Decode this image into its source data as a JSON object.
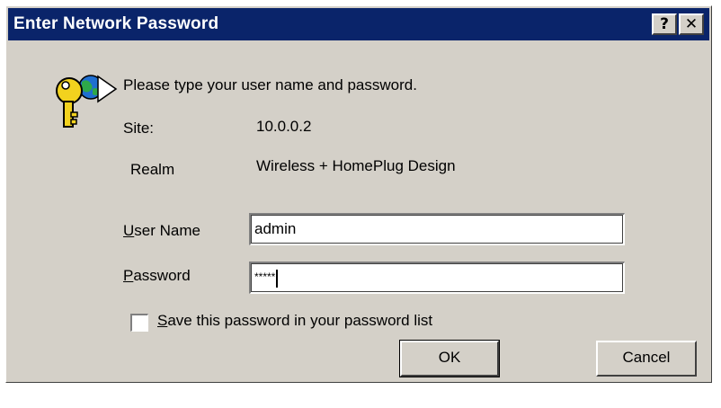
{
  "dialog": {
    "title": "Enter Network Password",
    "help_glyph": "?",
    "close_glyph": "✕",
    "prompt": "Please type your user name and password.",
    "icon": "key-icon"
  },
  "site": {
    "label": "Site:",
    "value": "10.0.0.2"
  },
  "realm": {
    "label": "Realm",
    "value": "Wireless + HomePlug Design"
  },
  "username": {
    "label_mnemonic": "U",
    "label_rest": "ser Name",
    "value": "admin"
  },
  "password": {
    "label_mnemonic": "P",
    "label_rest": "assword",
    "value_masked": "*****"
  },
  "save_password": {
    "label_mnemonic": "S",
    "label_rest": "ave this password in your password list",
    "checked": false
  },
  "buttons": {
    "ok": "OK",
    "cancel": "Cancel"
  },
  "colors": {
    "titlebar": "#0a246a",
    "face": "#d4d0c8"
  }
}
